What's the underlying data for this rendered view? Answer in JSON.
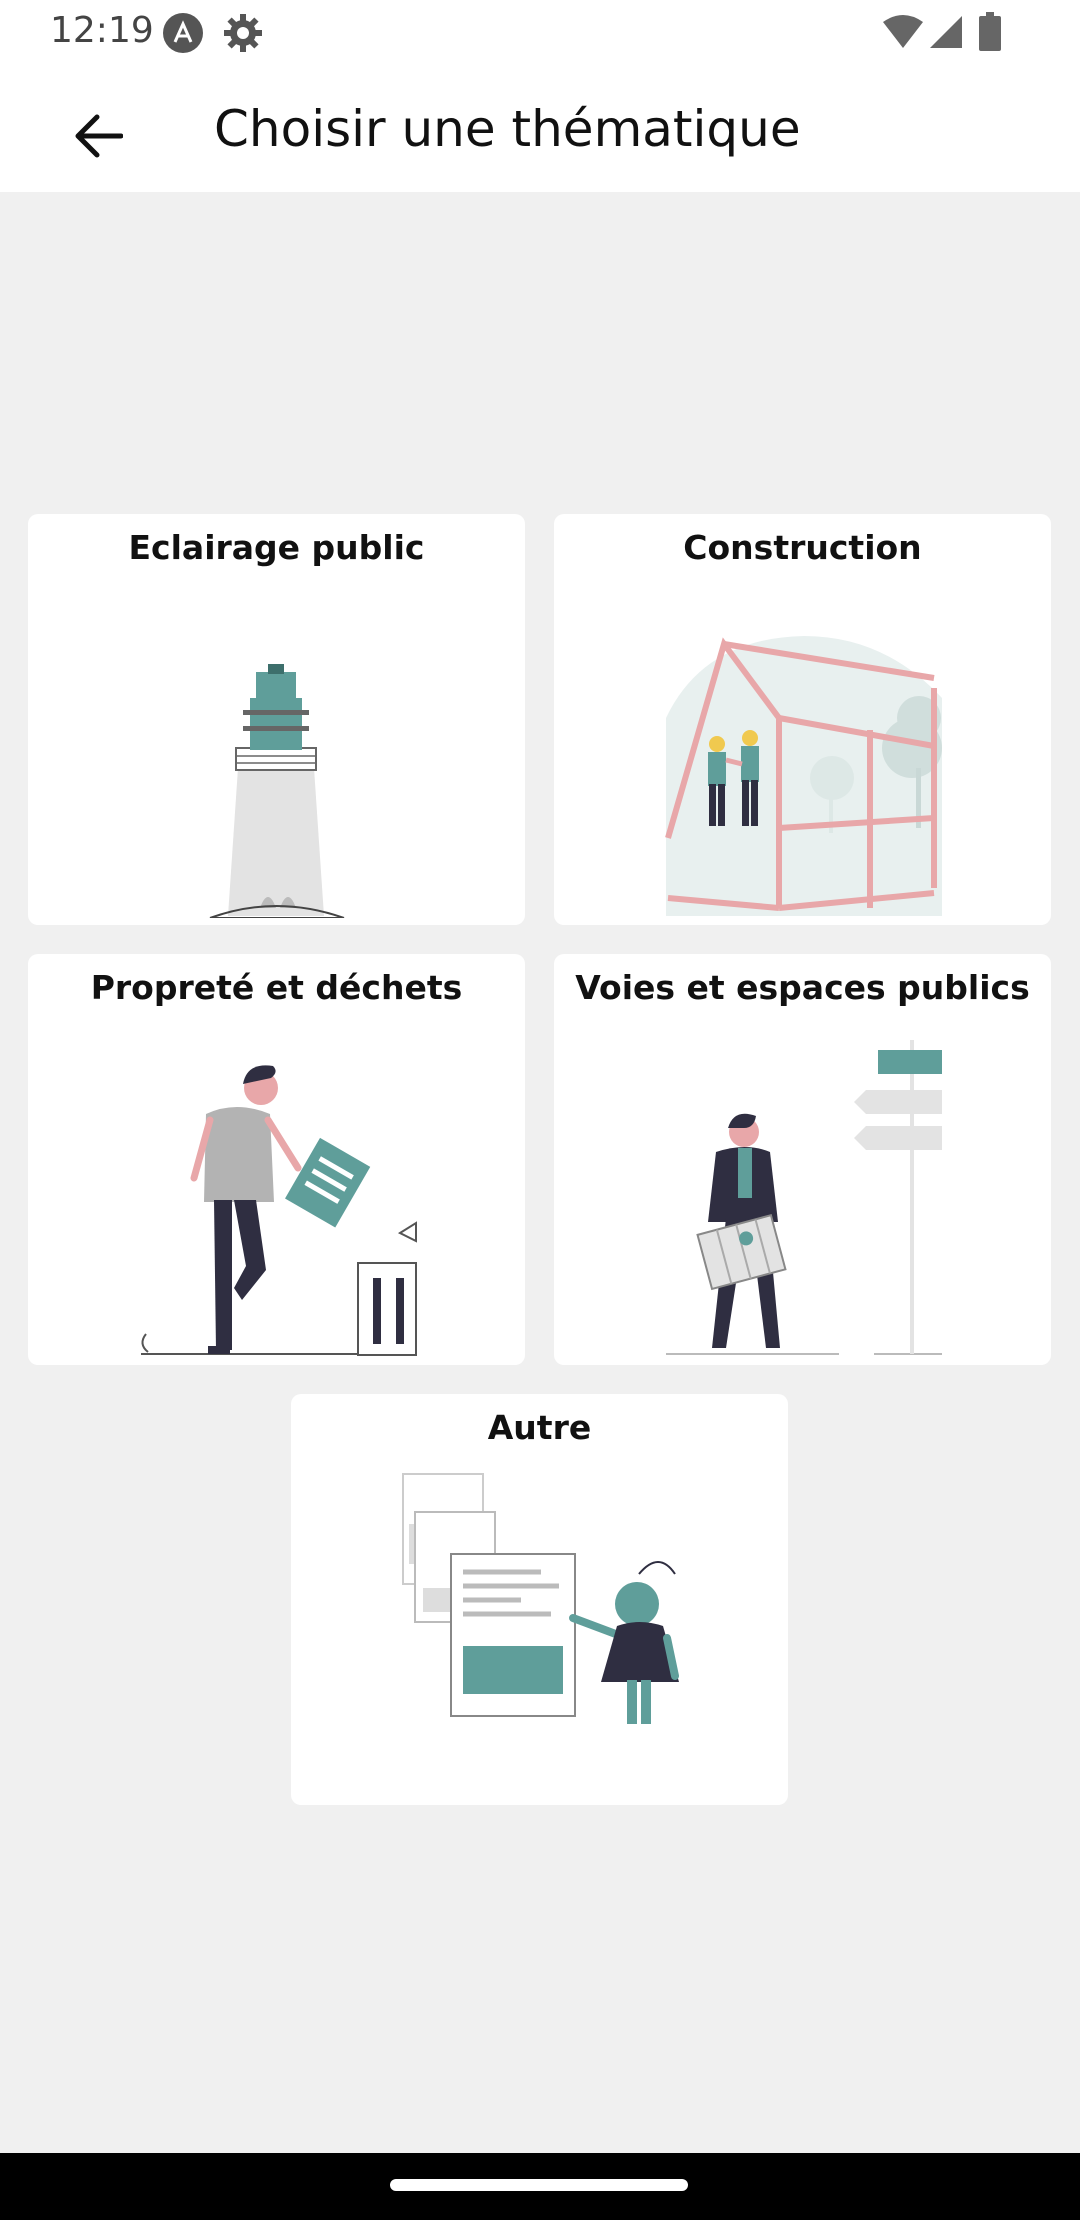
{
  "status_bar": {
    "time": "12:19"
  },
  "app_bar": {
    "title": "Choisir une thématique"
  },
  "cards": [
    {
      "title": "Eclairage public"
    },
    {
      "title": "Construction"
    },
    {
      "title": "Propreté et déchets"
    },
    {
      "title": "Voies et espaces publics"
    },
    {
      "title": "Autre"
    }
  ],
  "colors": {
    "accent_teal": "#5f9e9a",
    "dark_navy": "#2f2e41",
    "pink": "#e8a7a9",
    "light_gray": "#e3e3e3",
    "background": "#f0f0f0"
  }
}
